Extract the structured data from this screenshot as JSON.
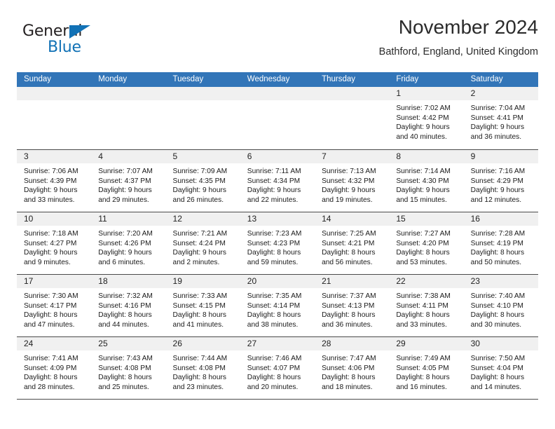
{
  "brand": {
    "name_part1": "General",
    "name_part2": "Blue",
    "triangle_icon": "triangle-icon",
    "colors": {
      "dark": "#231f20",
      "blue": "#1272b6"
    }
  },
  "header": {
    "title": "November 2024",
    "subtitle": "Bathford, England, United Kingdom"
  },
  "calendar": {
    "accent_color": "#3275b8",
    "daynum_band_color": "#f0f0f0",
    "weekdays": [
      "Sunday",
      "Monday",
      "Tuesday",
      "Wednesday",
      "Thursday",
      "Friday",
      "Saturday"
    ],
    "weeks": [
      [
        {
          "day": "",
          "empty": true,
          "lines": []
        },
        {
          "day": "",
          "empty": true,
          "lines": []
        },
        {
          "day": "",
          "empty": true,
          "lines": []
        },
        {
          "day": "",
          "empty": true,
          "lines": []
        },
        {
          "day": "",
          "empty": true,
          "lines": []
        },
        {
          "day": "1",
          "empty": false,
          "lines": [
            "Sunrise: 7:02 AM",
            "Sunset: 4:42 PM",
            "Daylight: 9 hours",
            "and 40 minutes."
          ]
        },
        {
          "day": "2",
          "empty": false,
          "lines": [
            "Sunrise: 7:04 AM",
            "Sunset: 4:41 PM",
            "Daylight: 9 hours",
            "and 36 minutes."
          ]
        }
      ],
      [
        {
          "day": "3",
          "empty": false,
          "lines": [
            "Sunrise: 7:06 AM",
            "Sunset: 4:39 PM",
            "Daylight: 9 hours",
            "and 33 minutes."
          ]
        },
        {
          "day": "4",
          "empty": false,
          "lines": [
            "Sunrise: 7:07 AM",
            "Sunset: 4:37 PM",
            "Daylight: 9 hours",
            "and 29 minutes."
          ]
        },
        {
          "day": "5",
          "empty": false,
          "lines": [
            "Sunrise: 7:09 AM",
            "Sunset: 4:35 PM",
            "Daylight: 9 hours",
            "and 26 minutes."
          ]
        },
        {
          "day": "6",
          "empty": false,
          "lines": [
            "Sunrise: 7:11 AM",
            "Sunset: 4:34 PM",
            "Daylight: 9 hours",
            "and 22 minutes."
          ]
        },
        {
          "day": "7",
          "empty": false,
          "lines": [
            "Sunrise: 7:13 AM",
            "Sunset: 4:32 PM",
            "Daylight: 9 hours",
            "and 19 minutes."
          ]
        },
        {
          "day": "8",
          "empty": false,
          "lines": [
            "Sunrise: 7:14 AM",
            "Sunset: 4:30 PM",
            "Daylight: 9 hours",
            "and 15 minutes."
          ]
        },
        {
          "day": "9",
          "empty": false,
          "lines": [
            "Sunrise: 7:16 AM",
            "Sunset: 4:29 PM",
            "Daylight: 9 hours",
            "and 12 minutes."
          ]
        }
      ],
      [
        {
          "day": "10",
          "empty": false,
          "lines": [
            "Sunrise: 7:18 AM",
            "Sunset: 4:27 PM",
            "Daylight: 9 hours",
            "and 9 minutes."
          ]
        },
        {
          "day": "11",
          "empty": false,
          "lines": [
            "Sunrise: 7:20 AM",
            "Sunset: 4:26 PM",
            "Daylight: 9 hours",
            "and 6 minutes."
          ]
        },
        {
          "day": "12",
          "empty": false,
          "lines": [
            "Sunrise: 7:21 AM",
            "Sunset: 4:24 PM",
            "Daylight: 9 hours",
            "and 2 minutes."
          ]
        },
        {
          "day": "13",
          "empty": false,
          "lines": [
            "Sunrise: 7:23 AM",
            "Sunset: 4:23 PM",
            "Daylight: 8 hours",
            "and 59 minutes."
          ]
        },
        {
          "day": "14",
          "empty": false,
          "lines": [
            "Sunrise: 7:25 AM",
            "Sunset: 4:21 PM",
            "Daylight: 8 hours",
            "and 56 minutes."
          ]
        },
        {
          "day": "15",
          "empty": false,
          "lines": [
            "Sunrise: 7:27 AM",
            "Sunset: 4:20 PM",
            "Daylight: 8 hours",
            "and 53 minutes."
          ]
        },
        {
          "day": "16",
          "empty": false,
          "lines": [
            "Sunrise: 7:28 AM",
            "Sunset: 4:19 PM",
            "Daylight: 8 hours",
            "and 50 minutes."
          ]
        }
      ],
      [
        {
          "day": "17",
          "empty": false,
          "lines": [
            "Sunrise: 7:30 AM",
            "Sunset: 4:17 PM",
            "Daylight: 8 hours",
            "and 47 minutes."
          ]
        },
        {
          "day": "18",
          "empty": false,
          "lines": [
            "Sunrise: 7:32 AM",
            "Sunset: 4:16 PM",
            "Daylight: 8 hours",
            "and 44 minutes."
          ]
        },
        {
          "day": "19",
          "empty": false,
          "lines": [
            "Sunrise: 7:33 AM",
            "Sunset: 4:15 PM",
            "Daylight: 8 hours",
            "and 41 minutes."
          ]
        },
        {
          "day": "20",
          "empty": false,
          "lines": [
            "Sunrise: 7:35 AM",
            "Sunset: 4:14 PM",
            "Daylight: 8 hours",
            "and 38 minutes."
          ]
        },
        {
          "day": "21",
          "empty": false,
          "lines": [
            "Sunrise: 7:37 AM",
            "Sunset: 4:13 PM",
            "Daylight: 8 hours",
            "and 36 minutes."
          ]
        },
        {
          "day": "22",
          "empty": false,
          "lines": [
            "Sunrise: 7:38 AM",
            "Sunset: 4:11 PM",
            "Daylight: 8 hours",
            "and 33 minutes."
          ]
        },
        {
          "day": "23",
          "empty": false,
          "lines": [
            "Sunrise: 7:40 AM",
            "Sunset: 4:10 PM",
            "Daylight: 8 hours",
            "and 30 minutes."
          ]
        }
      ],
      [
        {
          "day": "24",
          "empty": false,
          "lines": [
            "Sunrise: 7:41 AM",
            "Sunset: 4:09 PM",
            "Daylight: 8 hours",
            "and 28 minutes."
          ]
        },
        {
          "day": "25",
          "empty": false,
          "lines": [
            "Sunrise: 7:43 AM",
            "Sunset: 4:08 PM",
            "Daylight: 8 hours",
            "and 25 minutes."
          ]
        },
        {
          "day": "26",
          "empty": false,
          "lines": [
            "Sunrise: 7:44 AM",
            "Sunset: 4:08 PM",
            "Daylight: 8 hours",
            "and 23 minutes."
          ]
        },
        {
          "day": "27",
          "empty": false,
          "lines": [
            "Sunrise: 7:46 AM",
            "Sunset: 4:07 PM",
            "Daylight: 8 hours",
            "and 20 minutes."
          ]
        },
        {
          "day": "28",
          "empty": false,
          "lines": [
            "Sunrise: 7:47 AM",
            "Sunset: 4:06 PM",
            "Daylight: 8 hours",
            "and 18 minutes."
          ]
        },
        {
          "day": "29",
          "empty": false,
          "lines": [
            "Sunrise: 7:49 AM",
            "Sunset: 4:05 PM",
            "Daylight: 8 hours",
            "and 16 minutes."
          ]
        },
        {
          "day": "30",
          "empty": false,
          "lines": [
            "Sunrise: 7:50 AM",
            "Sunset: 4:04 PM",
            "Daylight: 8 hours",
            "and 14 minutes."
          ]
        }
      ]
    ]
  }
}
